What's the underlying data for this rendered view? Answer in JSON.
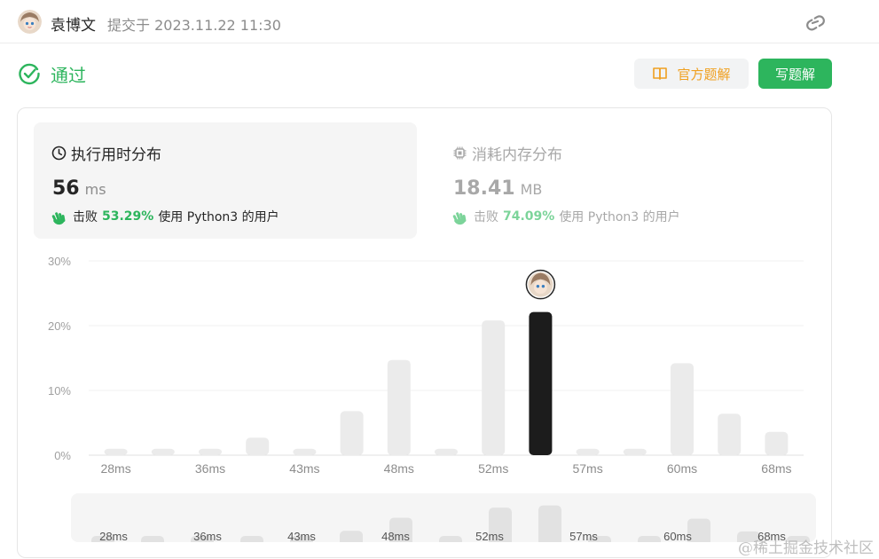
{
  "header": {
    "username": "袁博文",
    "submit_label": "提交于 2023.11.22 11:30"
  },
  "status": {
    "text": "通过",
    "color": "#2db55d"
  },
  "buttons": {
    "official_solution": "官方题解",
    "write_solution": "写题解"
  },
  "tabs": {
    "time": {
      "title": "执行用时分布",
      "value": "56",
      "unit": "ms",
      "beat_prefix": "击败",
      "beat_percent": "53.29%",
      "beat_suffix": "使用 Python3 的用户"
    },
    "memory": {
      "title": "消耗内存分布",
      "value": "18.41",
      "unit": "MB",
      "beat_prefix": "击败",
      "beat_percent": "74.09%",
      "beat_suffix": "使用 Python3 的用户"
    }
  },
  "chart_data": {
    "type": "bar",
    "y_ticks": [
      "0%",
      "10%",
      "20%",
      "30%"
    ],
    "ylim": [
      0,
      30
    ],
    "x_tick_labels": [
      "28ms",
      "36ms",
      "43ms",
      "48ms",
      "52ms",
      "57ms",
      "60ms",
      "68ms"
    ],
    "values": [
      1,
      1,
      1,
      2.7,
      1,
      6.8,
      14.7,
      1,
      20.8,
      22.1,
      1,
      1,
      14.2,
      6.4,
      3.6
    ],
    "highlight_index": 9,
    "highlight_color": "#1c1c1c",
    "bar_color": "#ebebeb",
    "grid": true,
    "brush_labels": [
      "28ms",
      "36ms",
      "43ms",
      "48ms",
      "52ms",
      "57ms",
      "60ms",
      "68ms"
    ]
  },
  "watermark": "@稀土掘金技术社区"
}
